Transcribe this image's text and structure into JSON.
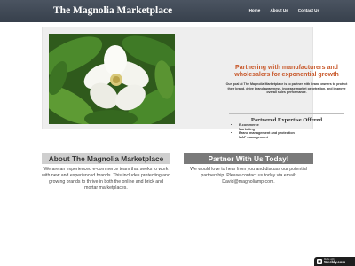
{
  "site": {
    "title": "The Magnolia Marketplace"
  },
  "nav": {
    "items": [
      {
        "label": "Home"
      },
      {
        "label": "About Us"
      },
      {
        "label": "Contact Us"
      }
    ]
  },
  "hero": {
    "image": "magnolia-flower-photo",
    "heading": "Partnering with manufacturers and wholesalers for exponential growth",
    "body": "Our goal at The Magnolia Marketplace is to partner with brand owners to protect their brand, drive brand awareness, increase market penetration, and improve overall sales performance.",
    "expertise_heading": "Partnered Expertise Offered",
    "expertise_items": [
      "E-commerce",
      "Marketing",
      "Brand management and protection",
      "MAP management"
    ]
  },
  "about": {
    "heading": "About The Magnolia Marketplace",
    "body": "We are an experienced e-commerce team that seeks to work with new and experienced brands. This includes protecting and growing brands to thrive in both the online and brick and mortar marketplaces."
  },
  "partner": {
    "heading": "Partner With Us Today!",
    "body": "We would love to hear from you and discuss our potential partnership. Please contact us today via email:  David@magnoliamp.com."
  },
  "badge": {
    "small": "Made with",
    "brand": "Weebly.com"
  },
  "colors": {
    "header_bg": "#3f4854",
    "accent_orange": "#c8582a",
    "hero_bg": "#eeeeee",
    "about_heading_bg": "#cfcfcf",
    "partner_heading_bg": "#7a7a7a"
  }
}
